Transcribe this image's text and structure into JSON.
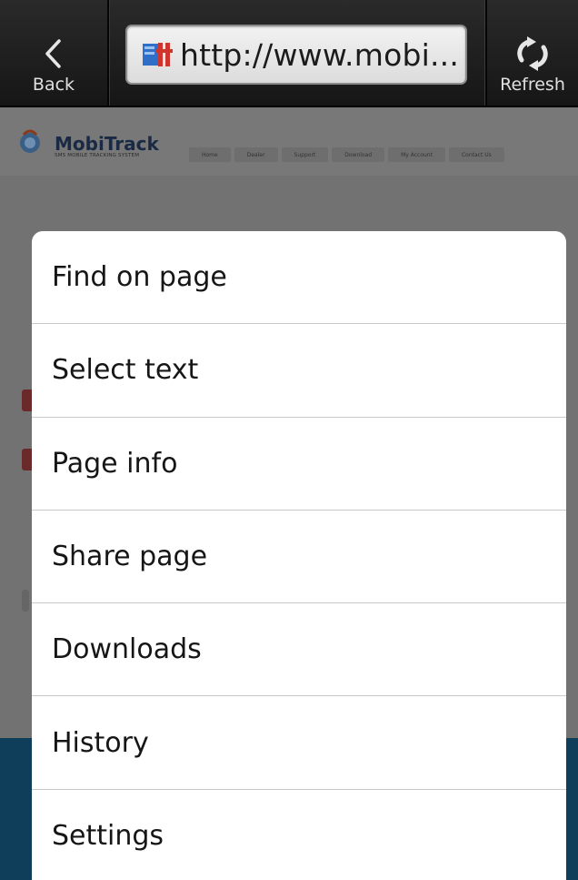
{
  "toolbar": {
    "back_label": "Back",
    "refresh_label": "Refresh",
    "url": "http://www.mobi...",
    "back_icon": "chevron-left-icon",
    "refresh_icon": "refresh-icon"
  },
  "webpage": {
    "site_name": "MobiTrack",
    "site_tagline": "SMS MOBILE TRACKING SYSTEM",
    "nav_items": [
      "Home",
      "Dealer",
      "Support",
      "Download",
      "My Account",
      "Contact Us"
    ]
  },
  "menu": {
    "items": [
      {
        "label": "Find on page"
      },
      {
        "label": "Select text"
      },
      {
        "label": "Page info"
      },
      {
        "label": "Share page"
      },
      {
        "label": "Downloads"
      },
      {
        "label": "History"
      },
      {
        "label": "Settings"
      }
    ]
  },
  "colors": {
    "toolbar_bg": "#1e1e1e",
    "menu_bg": "#ffffff",
    "footer_band": "#0f3e5a",
    "favicon_blue": "#2f6fc8",
    "favicon_red": "#d0342c"
  }
}
